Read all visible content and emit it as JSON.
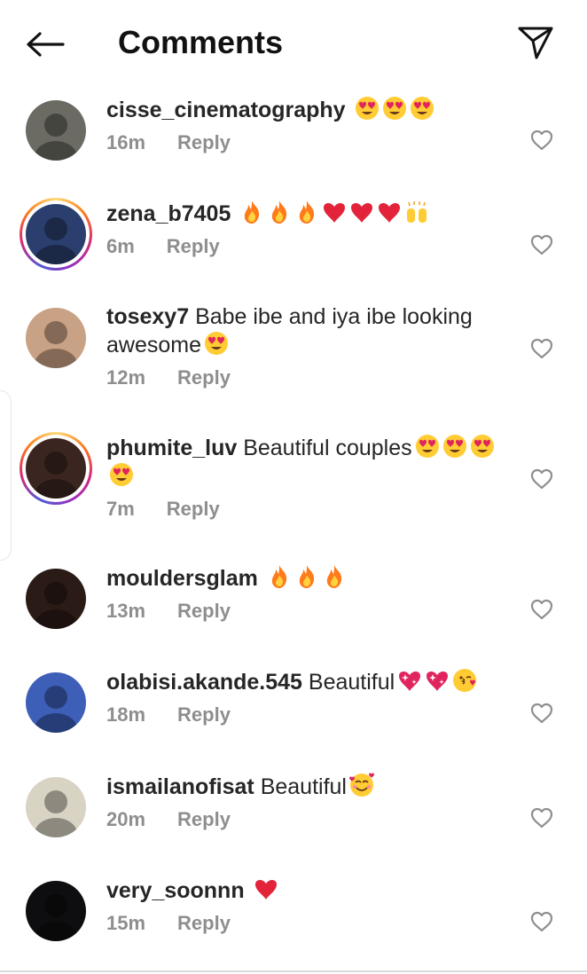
{
  "header": {
    "title": "Comments",
    "back_icon": "arrow-left-icon",
    "send_icon": "paper-plane-icon"
  },
  "comments": [
    {
      "username": "cisse_cinematography",
      "text": "",
      "emojis": [
        "heart-eyes",
        "heart-eyes",
        "heart-eyes"
      ],
      "time": "16m",
      "reply": "Reply",
      "story_ring": false,
      "avatar_color": "#6b6a63"
    },
    {
      "username": "zena_b7405",
      "text": "",
      "emojis": [
        "fire",
        "fire",
        "fire",
        "red-heart",
        "red-heart",
        "red-heart",
        "raising-hands"
      ],
      "time": "6m",
      "reply": "Reply",
      "story_ring": true,
      "avatar_color": "#2a3f6e"
    },
    {
      "username": "tosexy7",
      "text": "Babe ibe and iya ibe looking awesome",
      "emojis": [
        "heart-eyes"
      ],
      "time": "12m",
      "reply": "Reply",
      "story_ring": false,
      "avatar_color": "#c9a184"
    },
    {
      "username": "phumite_luv",
      "text": "Beautiful couples",
      "emojis": [
        "heart-eyes",
        "heart-eyes",
        "heart-eyes",
        "heart-eyes"
      ],
      "time": "7m",
      "reply": "Reply",
      "story_ring": true,
      "avatar_color": "#3b2520"
    },
    {
      "username": "mouldersglam",
      "text": "",
      "emojis": [
        "fire",
        "fire",
        "fire"
      ],
      "time": "13m",
      "reply": "Reply",
      "story_ring": false,
      "avatar_color": "#2b1b16"
    },
    {
      "username": "olabisi.akande.545",
      "text": "Beautiful",
      "emojis": [
        "sparkling-heart",
        "sparkling-heart",
        "kissing-face"
      ],
      "time": "18m",
      "reply": "Reply",
      "story_ring": false,
      "avatar_color": "#3d5fb8"
    },
    {
      "username": "ismailanofisat",
      "text": "Beautiful",
      "emojis": [
        "smiling-face-hearts"
      ],
      "time": "20m",
      "reply": "Reply",
      "story_ring": false,
      "avatar_color": "#d9d3c4"
    },
    {
      "username": "very_soonnn",
      "text": "",
      "emojis": [
        "red-heart"
      ],
      "time": "15m",
      "reply": "Reply",
      "story_ring": false,
      "avatar_color": "#0e0e10"
    }
  ],
  "like_icon": "heart-outline-icon",
  "colors": {
    "text": "#262626",
    "muted": "#8e8e8e",
    "heart": "#e0245e",
    "fire": "#ff7a1a"
  }
}
